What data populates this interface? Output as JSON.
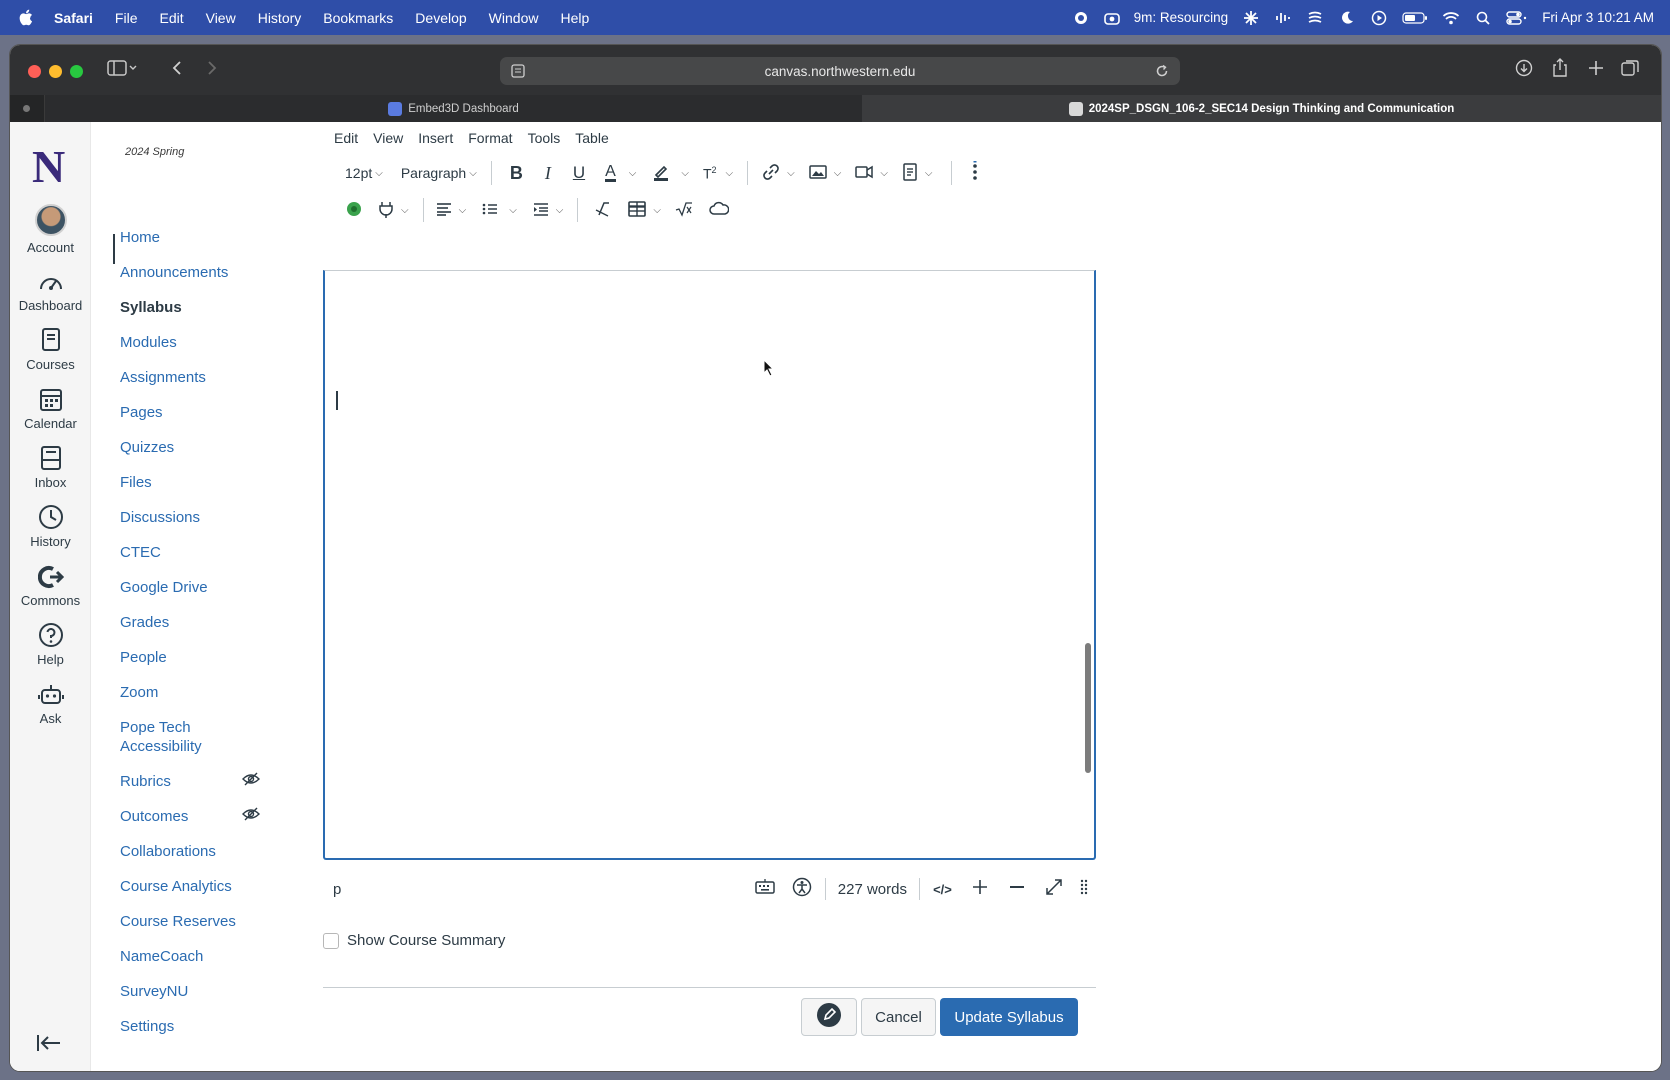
{
  "menubar": {
    "app": "Safari",
    "items": [
      "File",
      "Edit",
      "View",
      "History",
      "Bookmarks",
      "Develop",
      "Window",
      "Help"
    ],
    "status_timer": "9m: Resourcing",
    "datetime": "Fri Apr 3  10:21 AM"
  },
  "browser": {
    "url": "canvas.northwestern.edu",
    "tabs": [
      {
        "title": "Embed3D Dashboard",
        "favicon_color": "#5a7be0"
      },
      {
        "title": "2024SP_DSGN_106-2_SEC14 Design Thinking and Communication",
        "favicon_color": "#cccccc"
      }
    ]
  },
  "global_nav": {
    "logo": "N",
    "items": [
      {
        "label": "Account",
        "icon": "avatar"
      },
      {
        "label": "Dashboard",
        "icon": "dashboard-icon"
      },
      {
        "label": "Courses",
        "icon": "courses-icon"
      },
      {
        "label": "Calendar",
        "icon": "calendar-icon"
      },
      {
        "label": "Inbox",
        "icon": "inbox-icon"
      },
      {
        "label": "History",
        "icon": "history-icon"
      },
      {
        "label": "Commons",
        "icon": "commons-icon"
      },
      {
        "label": "Help",
        "icon": "help-icon"
      },
      {
        "label": "Ask",
        "icon": "ask-icon"
      }
    ]
  },
  "course_nav": {
    "term": "2024 Spring",
    "active": "Syllabus",
    "items": [
      "Home",
      "Announcements",
      "Syllabus",
      "Modules",
      "Assignments",
      "Pages",
      "Quizzes",
      "Files",
      "Discussions",
      "CTEC",
      "Google Drive",
      "Grades",
      "People",
      "Zoom",
      "Pope Tech Accessibility",
      "Rubrics",
      "Outcomes",
      "Collaborations",
      "Course Analytics",
      "Course Reserves",
      "NameCoach",
      "SurveyNU",
      "Settings"
    ],
    "hidden_items": [
      "Rubrics",
      "Outcomes"
    ]
  },
  "editor": {
    "menus": [
      "Edit",
      "View",
      "Insert",
      "Format",
      "Tools",
      "Table"
    ],
    "font_size": "12pt",
    "block_format": "Paragraph",
    "element_path": "p",
    "word_count": "227 words",
    "html_toggle": "</>"
  },
  "form": {
    "show_summary_label": "Show Course Summary",
    "cancel_label": "Cancel",
    "update_label": "Update Syllabus"
  },
  "colors": {
    "link": "#2a6bb1",
    "text": "#2d3b45",
    "menubar": "#2f4ea8",
    "primary_button": "#2a6bb1"
  }
}
